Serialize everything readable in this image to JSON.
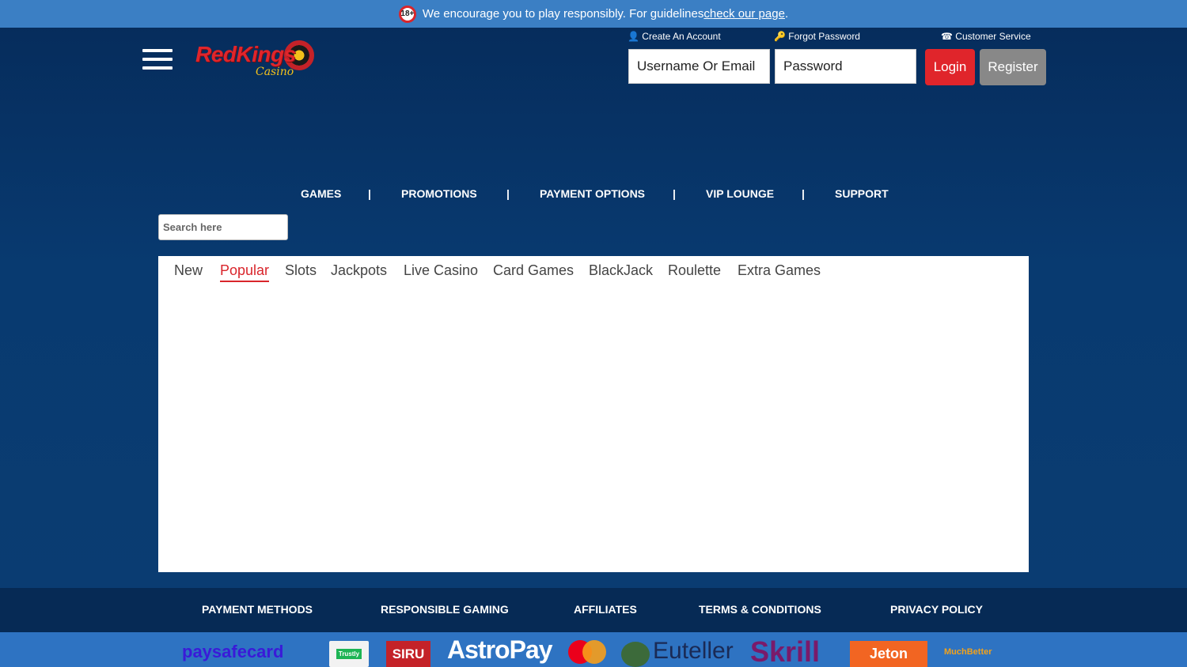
{
  "notice": {
    "age": "18+",
    "text": "We encourage you to play responsibly. For guidelines ",
    "link": "check our page",
    "tail": "."
  },
  "logo": {
    "brand": "RedKings",
    "sub": "Casino"
  },
  "account_links": {
    "create": "Create An Account",
    "forgot": "Forgot Password",
    "service": "Customer Service"
  },
  "login": {
    "username_placeholder": "Username Or Email",
    "password_placeholder": "Password",
    "login_label": "Login",
    "register_label": "Register"
  },
  "nav": [
    "GAMES",
    "PROMOTIONS",
    "PAYMENT OPTIONS",
    "VIP LOUNGE",
    "SUPPORT"
  ],
  "search": {
    "placeholder": "Search here"
  },
  "tabs": [
    "New",
    "Popular",
    "Slots",
    "Jackpots",
    "Live Casino",
    "Card Games",
    "BlackJack",
    "Roulette",
    "Extra Games"
  ],
  "active_tab": "Popular",
  "footer_nav": [
    "PAYMENT METHODS",
    "RESPONSIBLE GAMING",
    "AFFILIATES",
    "TERMS & CONDITIONS",
    "PRIVACY POLICY"
  ],
  "payments": [
    "paysafecard",
    "Trustly",
    "SIRU",
    "AstroPay",
    "mastercard",
    "Euteller",
    "Skrill",
    "Jeton",
    "MuchBetter"
  ],
  "colors": {
    "accent": "#e0252b",
    "topbar": "#3b7fc4",
    "background": "#0b3d72"
  }
}
